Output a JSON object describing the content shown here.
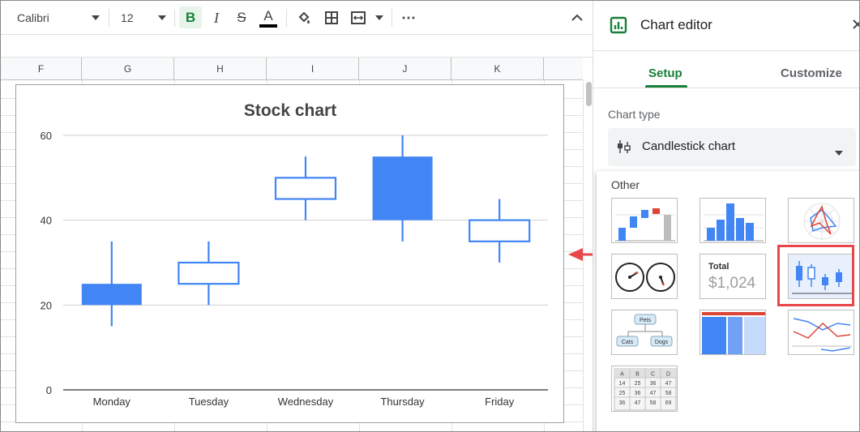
{
  "toolbar": {
    "font_name": "Calibri",
    "font_size": "12",
    "bold_label": "B",
    "italic_label": "I",
    "strike_label": "S",
    "text_color_label": "A",
    "more_label": "⋯"
  },
  "columns": [
    "F",
    "G",
    "H",
    "I",
    "J",
    "K"
  ],
  "chart": {
    "title": "Stock chart"
  },
  "chart_data": {
    "type": "candlestick",
    "title": "Stock chart",
    "categories": [
      "Monday",
      "Tuesday",
      "Wednesday",
      "Thursday",
      "Friday"
    ],
    "low": [
      15,
      20,
      40,
      35,
      30
    ],
    "open": [
      25,
      25,
      45,
      55,
      35
    ],
    "close": [
      20,
      30,
      50,
      40,
      40
    ],
    "high": [
      35,
      35,
      55,
      60,
      45
    ],
    "yticks": [
      0,
      20,
      40,
      60
    ],
    "ylim": [
      0,
      60
    ],
    "grid": true,
    "colors": {
      "falling": "#4285f4",
      "rising_stroke": "#4285f4",
      "rising_fill": "#ffffff"
    }
  },
  "editor": {
    "title": "Chart editor",
    "tabs": [
      {
        "label": "Setup"
      },
      {
        "label": "Customize"
      }
    ],
    "chart_type_label": "Chart type",
    "chart_type_value": "Candlestick chart",
    "popup": {
      "section_title": "Other",
      "items": [
        {
          "name": "waterfall-chart"
        },
        {
          "name": "histogram-chart"
        },
        {
          "name": "radar-chart"
        },
        {
          "name": "gauge-chart"
        },
        {
          "name": "scorecard-chart",
          "label": "Total",
          "value": "$1,024"
        },
        {
          "name": "candlestick-chart",
          "selected": true
        },
        {
          "name": "org-chart",
          "top": "Pets",
          "left": "Cats",
          "right": "Dogs"
        },
        {
          "name": "treemap-chart"
        },
        {
          "name": "timeline-chart"
        },
        {
          "name": "table-chart",
          "header": [
            "A",
            "B",
            "C",
            "D"
          ],
          "rows": [
            [
              "14",
              "25",
              "36",
              "47"
            ],
            [
              "25",
              "36",
              "47",
              "58"
            ],
            [
              "36",
              "47",
              "58",
              "69"
            ]
          ]
        }
      ]
    }
  },
  "accent_colors": {
    "green": "#188038",
    "highlight": "#e8474a",
    "blue": "#4285f4"
  }
}
